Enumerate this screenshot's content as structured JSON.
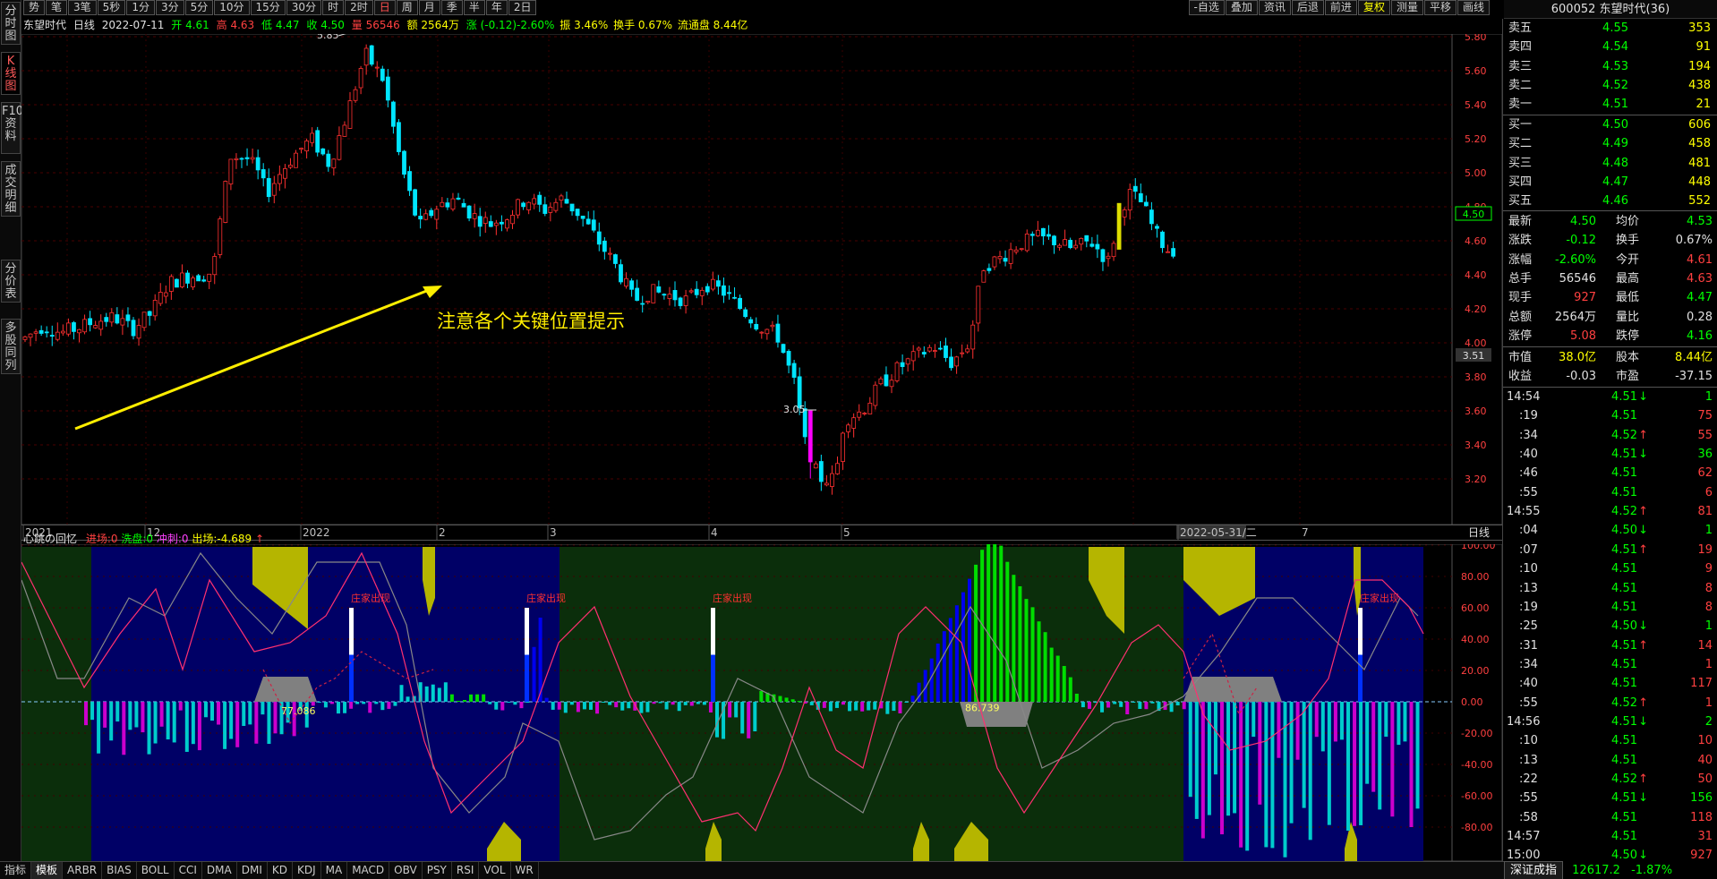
{
  "left_tabs": [
    {
      "label": "分时图"
    },
    {
      "label": "K线图"
    },
    {
      "label": "F10资料"
    },
    {
      "label": "成交明细"
    },
    {
      "label": "分价表"
    },
    {
      "label": "多股同列"
    }
  ],
  "top_periods": [
    "势",
    "笔",
    "3笔",
    "5秒",
    "1分",
    "3分",
    "5分",
    "10分",
    "15分",
    "30分",
    "时",
    "2时",
    "日",
    "周",
    "月",
    "季",
    "半",
    "年",
    "2日"
  ],
  "selected_period": "日",
  "right_buttons": [
    "-自选",
    "叠加",
    "资讯",
    "后退",
    "前进",
    "复权",
    "测量",
    "平移",
    "画线"
  ],
  "info_bar": {
    "name": "东望时代",
    "period": "日线",
    "date": "2022-07-11",
    "open": "开 4.61",
    "high": "高 4.63",
    "low": "低 4.47",
    "close": "收 4.50",
    "volume": "量 56546",
    "amount": "额 2564万",
    "change": "涨 (-0.12)-2.60%",
    "amplitude": "振 3.46%",
    "turnover": "换手 0.67%",
    "float_cap": "流通盘 8.44亿"
  },
  "stock_title": "600052 东望时代(36)",
  "orderbook": {
    "sell": [
      {
        "label": "卖五",
        "price": "4.55",
        "vol": "353"
      },
      {
        "label": "卖四",
        "price": "4.54",
        "vol": "91"
      },
      {
        "label": "卖三",
        "price": "4.53",
        "vol": "194"
      },
      {
        "label": "卖二",
        "price": "4.52",
        "vol": "438"
      },
      {
        "label": "卖一",
        "price": "4.51",
        "vol": "21"
      }
    ],
    "buy": [
      {
        "label": "买一",
        "price": "4.50",
        "vol": "606"
      },
      {
        "label": "买二",
        "price": "4.49",
        "vol": "458"
      },
      {
        "label": "买三",
        "price": "4.48",
        "vol": "481"
      },
      {
        "label": "买四",
        "price": "4.47",
        "vol": "448"
      },
      {
        "label": "买五",
        "price": "4.46",
        "vol": "552"
      }
    ]
  },
  "quote": [
    {
      "l1": "最新",
      "v1": "4.50",
      "c1": "#00ff00",
      "l2": "均价",
      "v2": "4.53",
      "c2": "#00ff00"
    },
    {
      "l1": "涨跌",
      "v1": "-0.12",
      "c1": "#00ff00",
      "l2": "换手",
      "v2": "0.67%",
      "c2": "#e0e0e0"
    },
    {
      "l1": "涨幅",
      "v1": "-2.60%",
      "c1": "#00ff00",
      "l2": "今开",
      "v2": "4.61",
      "c2": "#ff4040"
    },
    {
      "l1": "总手",
      "v1": "56546",
      "c1": "#e0e0e0",
      "l2": "最高",
      "v2": "4.63",
      "c2": "#ff4040"
    },
    {
      "l1": "现手",
      "v1": "927",
      "c1": "#ff4040",
      "l2": "最低",
      "v2": "4.47",
      "c2": "#00ff00"
    },
    {
      "l1": "总额",
      "v1": "2564万",
      "c1": "#e0e0e0",
      "l2": "量比",
      "v2": "0.28",
      "c2": "#e0e0e0"
    },
    {
      "l1": "涨停",
      "v1": "5.08",
      "c1": "#ff4040",
      "l2": "跌停",
      "v2": "4.16",
      "c2": "#00ff00"
    }
  ],
  "cap": [
    {
      "l1": "市值",
      "v1": "38.0亿",
      "c1": "#ffff00",
      "l2": "股本",
      "v2": "8.44亿",
      "c2": "#ffff00"
    },
    {
      "l1": "收益",
      "v1": "-0.03",
      "c1": "#e0e0e0",
      "l2": "市盈",
      "v2": "-37.15",
      "c2": "#e0e0e0"
    }
  ],
  "ticks": [
    {
      "t": "14:54",
      "p": "4.51",
      "d": "↓",
      "v": "1"
    },
    {
      "t": ":19",
      "p": "4.51",
      "d": "",
      "v": "75"
    },
    {
      "t": ":34",
      "p": "4.52",
      "d": "↑",
      "v": "55"
    },
    {
      "t": ":40",
      "p": "4.51",
      "d": "↓",
      "v": "36"
    },
    {
      "t": ":46",
      "p": "4.51",
      "d": "",
      "v": "62"
    },
    {
      "t": ":55",
      "p": "4.51",
      "d": "",
      "v": "6"
    },
    {
      "t": "14:55",
      "p": "4.52",
      "d": "↑",
      "v": "81"
    },
    {
      "t": ":04",
      "p": "4.50",
      "d": "↓",
      "v": "1"
    },
    {
      "t": ":07",
      "p": "4.51",
      "d": "↑",
      "v": "19"
    },
    {
      "t": ":10",
      "p": "4.51",
      "d": "",
      "v": "9"
    },
    {
      "t": ":13",
      "p": "4.51",
      "d": "",
      "v": "8"
    },
    {
      "t": ":19",
      "p": "4.51",
      "d": "",
      "v": "8"
    },
    {
      "t": ":25",
      "p": "4.50",
      "d": "↓",
      "v": "1"
    },
    {
      "t": ":31",
      "p": "4.51",
      "d": "↑",
      "v": "14"
    },
    {
      "t": ":34",
      "p": "4.51",
      "d": "",
      "v": "1"
    },
    {
      "t": ":40",
      "p": "4.51",
      "d": "",
      "v": "117"
    },
    {
      "t": ":55",
      "p": "4.52",
      "d": "↑",
      "v": "1"
    },
    {
      "t": "14:56",
      "p": "4.51",
      "d": "↓",
      "v": "2"
    },
    {
      "t": ":10",
      "p": "4.51",
      "d": "",
      "v": "10"
    },
    {
      "t": ":13",
      "p": "4.51",
      "d": "",
      "v": "40"
    },
    {
      "t": ":22",
      "p": "4.52",
      "d": "↑",
      "v": "50"
    },
    {
      "t": ":55",
      "p": "4.51",
      "d": "↓",
      "v": "156"
    },
    {
      "t": ":58",
      "p": "4.51",
      "d": "",
      "v": "118"
    },
    {
      "t": "14:57",
      "p": "4.51",
      "d": "",
      "v": "31"
    },
    {
      "t": "15:00",
      "p": "4.50",
      "d": "↓",
      "v": "927"
    }
  ],
  "bottom_tabs": [
    "指标",
    "模板",
    "ARBR",
    "BIAS",
    "BOLL",
    "CCI",
    "DMA",
    "DMI",
    "KD",
    "KDJ",
    "MA",
    "MACD",
    "OBV",
    "PSY",
    "RSI",
    "VOL",
    "WR"
  ],
  "index_bar": {
    "name": "深证成指",
    "value": "12617.2",
    "change": "-1.87%"
  },
  "main_chart": {
    "y_labels": [
      "5.80",
      "5.60",
      "5.40",
      "5.20",
      "5.00",
      "4.80",
      "4.60",
      "4.40",
      "4.20",
      "4.00",
      "3.80",
      "3.60",
      "3.40",
      "3.20"
    ],
    "x_labels": [
      "2021",
      "12",
      "2022",
      "2",
      "3",
      "4",
      "5",
      "2022-05-31/二",
      "7"
    ],
    "period_label": "日线",
    "price_tag": "4.50",
    "cursor_tag": "3.51",
    "high_label": "5.85",
    "low_label": "3.05",
    "annotation": "注意各个关键位置提示"
  },
  "indicator": {
    "name": "心跳の回忆",
    "enter": "进场:0",
    "wash": "洗盘:0",
    "rush": "冲刺:0",
    "exit": "出场:-4.689",
    "y_labels": [
      "100.00",
      "80.00",
      "60.00",
      "40.00",
      "20.00",
      "0.00",
      "-20.00",
      "-40.00",
      "-60.00",
      "-80.00"
    ],
    "zhuang_label": "庄家出现",
    "val1": "77.086",
    "val2": "86.739"
  }
}
